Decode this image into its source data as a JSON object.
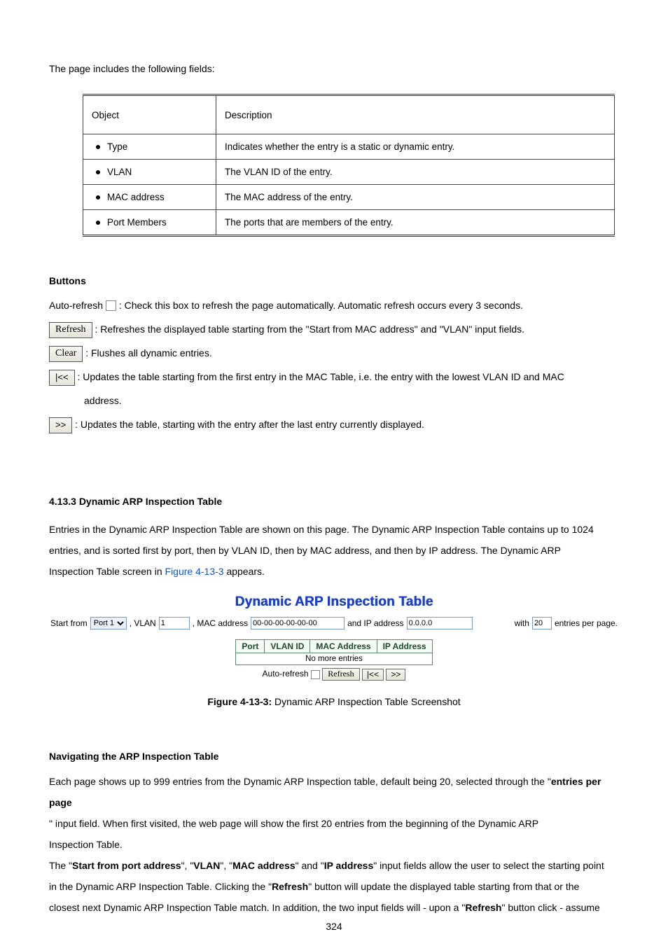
{
  "intro_line": "The page includes the following fields:",
  "fields_table": {
    "headers": [
      "Object",
      "Description"
    ],
    "rows": [
      {
        "label": "Type",
        "desc": "Indicates whether the entry is a static or dynamic entry."
      },
      {
        "label": "VLAN",
        "desc": "The VLAN ID of the entry."
      },
      {
        "label": "MAC address",
        "desc": "The MAC address of the entry."
      },
      {
        "label": "Port Members",
        "desc": "The ports that are members of the entry."
      }
    ]
  },
  "buttons_heading": "Buttons",
  "auto_refresh": {
    "prefix": "Auto-refresh ",
    "text": ": Check this box to refresh the page automatically. Automatic refresh occurs every 3 seconds."
  },
  "btn_refresh": {
    "label": "Refresh",
    "text": ": Refreshes the displayed table starting from the \"Start from MAC address\" and \"VLAN\" input fields."
  },
  "btn_clear": {
    "label": "Clear",
    "text": ": Flushes all dynamic entries."
  },
  "btn_first": {
    "label": "|<<",
    "text": ": Updates the table starting from the first entry in the MAC Table, i.e. the entry with the lowest VLAN ID and MAC",
    "text2": "address."
  },
  "btn_next": {
    "label": ">>",
    "text": ": Updates the table, starting with the entry after the last entry currently displayed."
  },
  "section_title": "4.13.3 Dynamic ARP Inspection Table",
  "dyn_intro_1": "Entries in the Dynamic ARP Inspection Table are shown on this page. The Dynamic ARP Inspection Table contains up to 1024",
  "dyn_intro_2": "entries, and is sorted first by port, then by VLAN ID, then by MAC address, and then by IP address. The Dynamic ARP",
  "dyn_intro_3a": "Inspection Table screen in ",
  "dyn_intro_3_figref": "Figure 4-13-3",
  "dyn_intro_3b": " appears.",
  "screenshot": {
    "title": "Dynamic ARP Inspection Table",
    "bar": {
      "start_from": "Start from",
      "port_value": "Port 1",
      "vlan_label": ", VLAN",
      "vlan_value": "1",
      "mac_label": ", MAC address",
      "mac_value": "00-00-00-00-00-00",
      "ip_label": "and IP address",
      "ip_value": "0.0.0.0",
      "with_label": "with",
      "with_value": "20",
      "tail": "entries per page."
    },
    "table_headers": [
      "Port",
      "VLAN ID",
      "MAC Address",
      "IP Address"
    ],
    "table_row_text": "No more entries",
    "controls": {
      "auto_label": "Auto-refresh",
      "refresh": "Refresh",
      "first": "|<<",
      "next": ">>"
    }
  },
  "caption_prefix": "Figure 4-13-3: ",
  "caption_text": "Dynamic ARP Inspection Table Screenshot",
  "nav_heading": "Navigating the ARP Inspection Table",
  "nav_p1a": "Each page shows up to 999 entries from the Dynamic ARP Inspection table, default being 20, selected through the \"",
  "nav_p1_bold1": "entries per page",
  "nav_p1b": "\" input field. When first visited, the web page will show the first 20 entries from the beginning of the Dynamic ARP",
  "nav_p1c": "Inspection Table.",
  "nav_p2a": "The \"",
  "nav_p2_bold1": "Start from port address",
  "nav_p2b": "\", \"",
  "nav_p2_bold2": "VLAN",
  "nav_p2c": "\", \"",
  "nav_p2_bold3": "MAC address",
  "nav_p2d": "\" and \"",
  "nav_p2_bold4": "IP address",
  "nav_p2e": "\" input fields allow the user to select the starting point",
  "nav_p3a": "in the Dynamic ARP Inspection Table. Clicking the \"",
  "nav_p3_bold1": "Refresh",
  "nav_p3b": "\" button will update the displayed table starting from that or the",
  "nav_p4a": "closest next Dynamic ARP Inspection Table match. In addition, the two input fields will - upon a \"",
  "nav_p4_bold1": "Refresh",
  "nav_p4b": "\" button click - assume",
  "page_number": "324"
}
